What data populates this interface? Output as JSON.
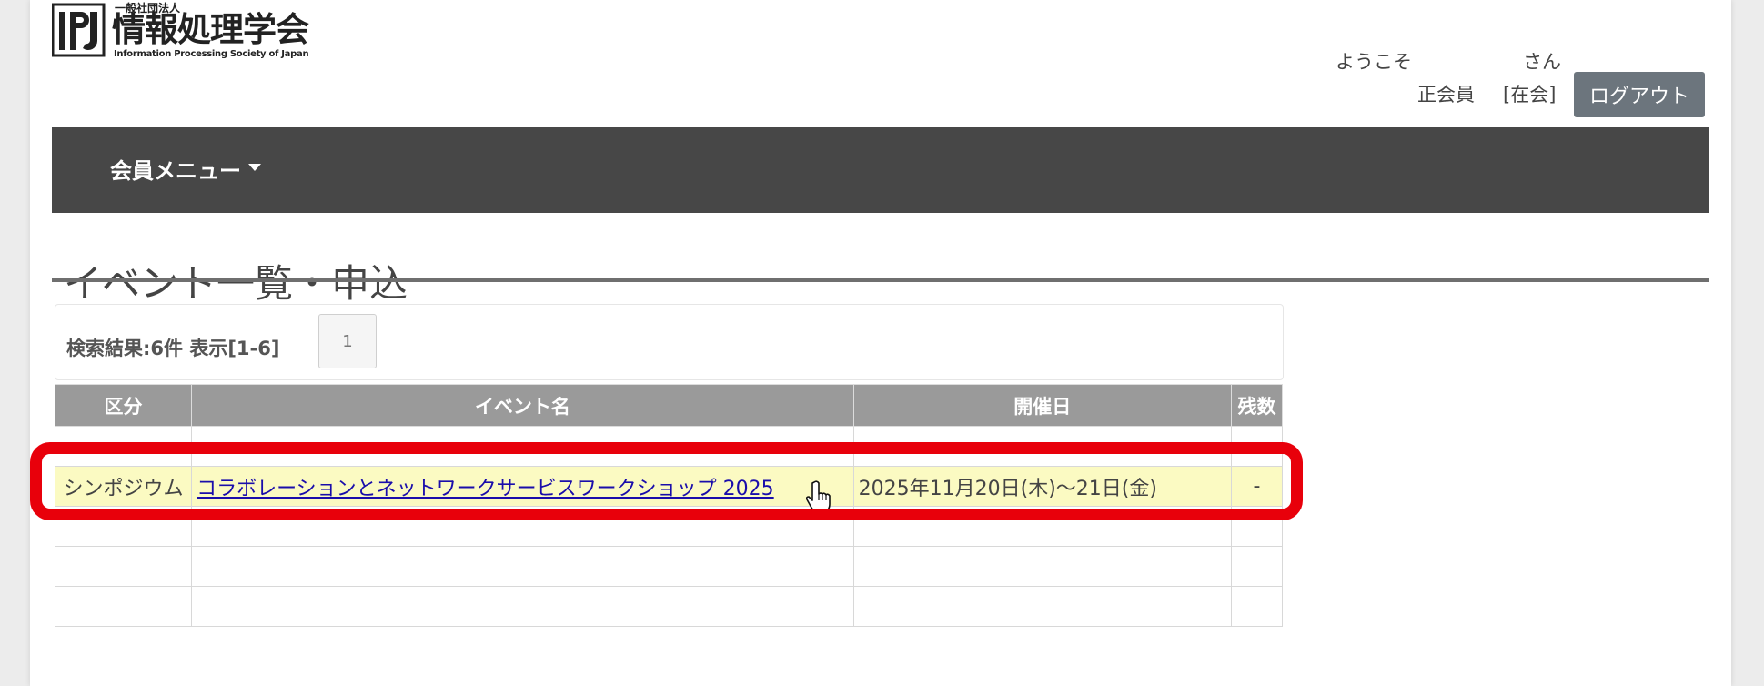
{
  "header": {
    "logo": {
      "corp": "一般社団法人",
      "name": "情報処理学会",
      "english": "Information Processing Society of Japan"
    },
    "welcome_prefix": "ようこそ",
    "welcome_suffix": "さん",
    "member_type": "正会員",
    "member_status": "[在会]",
    "logout_label": "ログアウト"
  },
  "navbar": {
    "menu_label": "会員メニュー"
  },
  "page_title": "イベント一覧・申込",
  "search": {
    "result_text": "検索結果:6件 表示[1-6]",
    "page_number": "1"
  },
  "table": {
    "headers": [
      "区分",
      "イベント名",
      "開催日",
      "残数"
    ],
    "highlighted_row": {
      "category": "シンポジウム",
      "event_name": "コラボレーションとネットワークサービスワークショップ 2025",
      "date": "2025年11月20日(木)～21日(金)",
      "remaining": "-"
    }
  },
  "colors": {
    "navbar": "#474747",
    "header_row": "#9a9a9a",
    "highlight_row": "#fbfac2",
    "annotation_box": "#e8000b",
    "logout_button": "#6c757d"
  }
}
